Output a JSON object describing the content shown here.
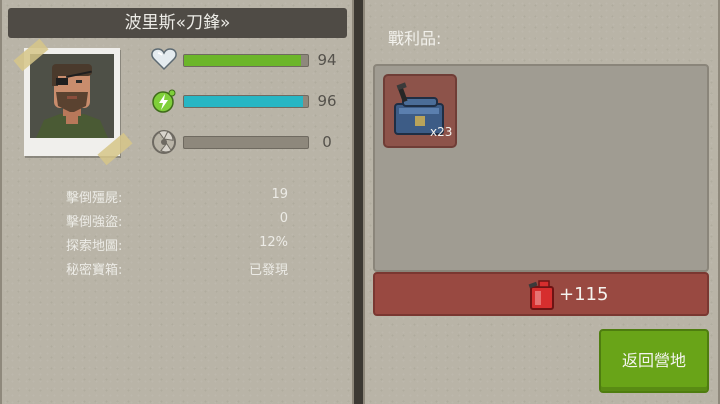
{
  "character": {
    "name": "波里斯«刀鋒»",
    "stats": [
      {
        "icon": "heart-icon",
        "value": "94",
        "fill": 0.94,
        "color": "#6cb62a"
      },
      {
        "icon": "energy-icon",
        "value": "96",
        "fill": 0.96,
        "color": "#27b6c4"
      },
      {
        "icon": "radiation-icon",
        "value": "0",
        "fill": 0.0,
        "color": "#c9c1a6"
      }
    ],
    "records": [
      {
        "label": "擊倒殭屍:",
        "value": "19"
      },
      {
        "label": "擊倒強盜:",
        "value": "0"
      },
      {
        "label": "探索地圖:",
        "value": "12%"
      },
      {
        "label": "秘密寶箱:",
        "value": "已發現"
      }
    ]
  },
  "loot": {
    "title": "戰利品:",
    "items": [
      {
        "icon": "fuel-canister-icon",
        "quantity": "x23"
      }
    ],
    "reward": {
      "icon": "gas-can-icon",
      "text": "+115"
    }
  },
  "actions": {
    "return_label": "返回營地"
  }
}
